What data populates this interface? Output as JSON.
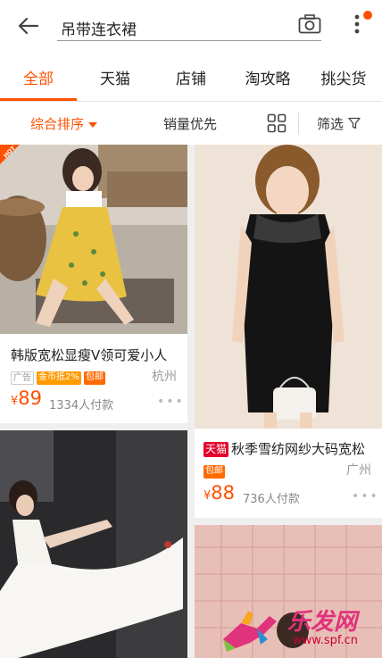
{
  "search": {
    "query": "吊带连衣裙"
  },
  "tabs": [
    "全部",
    "天猫",
    "店铺",
    "淘攻略",
    "挑尖货"
  ],
  "sort": {
    "comprehensive": "综合排序",
    "sales": "销量优先",
    "filter": "筛选"
  },
  "colors": {
    "accent": "#ff5000",
    "tmall": "#e4002b",
    "gold": "#ff9a00"
  },
  "products": [
    {
      "title": "韩版宽松显瘦V领可爱小人",
      "tags": [
        "广告",
        "金币抵2%",
        "包邮"
      ],
      "location": "杭州",
      "currency": "¥",
      "price": "89",
      "paid": "1334人付款",
      "badge": "HOT"
    },
    {
      "title": "秋季雪纺网纱大码宽松",
      "shop_tag": "天猫",
      "tags": [
        "包邮"
      ],
      "location": "广州",
      "currency": "¥",
      "price": "88",
      "paid": "736人付款"
    }
  ],
  "watermark": {
    "brand": "乐发网",
    "url": "www.spf.cn"
  }
}
